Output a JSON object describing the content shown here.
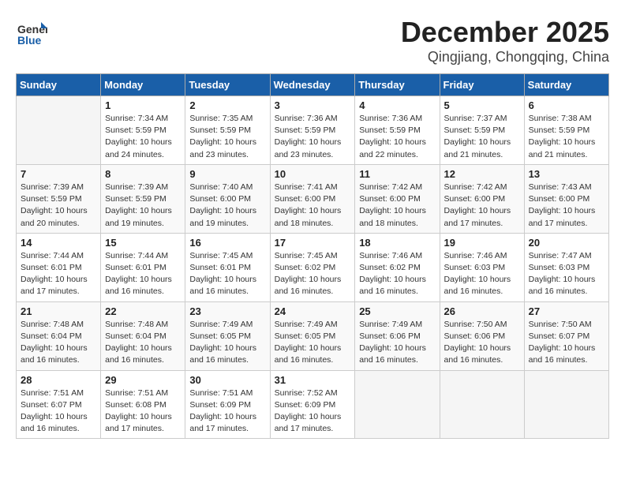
{
  "header": {
    "logo_general": "General",
    "logo_blue": "Blue",
    "month": "December 2025",
    "location": "Qingjiang, Chongqing, China"
  },
  "days_of_week": [
    "Sunday",
    "Monday",
    "Tuesday",
    "Wednesday",
    "Thursday",
    "Friday",
    "Saturday"
  ],
  "weeks": [
    [
      {
        "day": "",
        "info": ""
      },
      {
        "day": "1",
        "info": "Sunrise: 7:34 AM\nSunset: 5:59 PM\nDaylight: 10 hours\nand 24 minutes."
      },
      {
        "day": "2",
        "info": "Sunrise: 7:35 AM\nSunset: 5:59 PM\nDaylight: 10 hours\nand 23 minutes."
      },
      {
        "day": "3",
        "info": "Sunrise: 7:36 AM\nSunset: 5:59 PM\nDaylight: 10 hours\nand 23 minutes."
      },
      {
        "day": "4",
        "info": "Sunrise: 7:36 AM\nSunset: 5:59 PM\nDaylight: 10 hours\nand 22 minutes."
      },
      {
        "day": "5",
        "info": "Sunrise: 7:37 AM\nSunset: 5:59 PM\nDaylight: 10 hours\nand 21 minutes."
      },
      {
        "day": "6",
        "info": "Sunrise: 7:38 AM\nSunset: 5:59 PM\nDaylight: 10 hours\nand 21 minutes."
      }
    ],
    [
      {
        "day": "7",
        "info": "Sunrise: 7:39 AM\nSunset: 5:59 PM\nDaylight: 10 hours\nand 20 minutes."
      },
      {
        "day": "8",
        "info": "Sunrise: 7:39 AM\nSunset: 5:59 PM\nDaylight: 10 hours\nand 19 minutes."
      },
      {
        "day": "9",
        "info": "Sunrise: 7:40 AM\nSunset: 6:00 PM\nDaylight: 10 hours\nand 19 minutes."
      },
      {
        "day": "10",
        "info": "Sunrise: 7:41 AM\nSunset: 6:00 PM\nDaylight: 10 hours\nand 18 minutes."
      },
      {
        "day": "11",
        "info": "Sunrise: 7:42 AM\nSunset: 6:00 PM\nDaylight: 10 hours\nand 18 minutes."
      },
      {
        "day": "12",
        "info": "Sunrise: 7:42 AM\nSunset: 6:00 PM\nDaylight: 10 hours\nand 17 minutes."
      },
      {
        "day": "13",
        "info": "Sunrise: 7:43 AM\nSunset: 6:00 PM\nDaylight: 10 hours\nand 17 minutes."
      }
    ],
    [
      {
        "day": "14",
        "info": "Sunrise: 7:44 AM\nSunset: 6:01 PM\nDaylight: 10 hours\nand 17 minutes."
      },
      {
        "day": "15",
        "info": "Sunrise: 7:44 AM\nSunset: 6:01 PM\nDaylight: 10 hours\nand 16 minutes."
      },
      {
        "day": "16",
        "info": "Sunrise: 7:45 AM\nSunset: 6:01 PM\nDaylight: 10 hours\nand 16 minutes."
      },
      {
        "day": "17",
        "info": "Sunrise: 7:45 AM\nSunset: 6:02 PM\nDaylight: 10 hours\nand 16 minutes."
      },
      {
        "day": "18",
        "info": "Sunrise: 7:46 AM\nSunset: 6:02 PM\nDaylight: 10 hours\nand 16 minutes."
      },
      {
        "day": "19",
        "info": "Sunrise: 7:46 AM\nSunset: 6:03 PM\nDaylight: 10 hours\nand 16 minutes."
      },
      {
        "day": "20",
        "info": "Sunrise: 7:47 AM\nSunset: 6:03 PM\nDaylight: 10 hours\nand 16 minutes."
      }
    ],
    [
      {
        "day": "21",
        "info": "Sunrise: 7:48 AM\nSunset: 6:04 PM\nDaylight: 10 hours\nand 16 minutes."
      },
      {
        "day": "22",
        "info": "Sunrise: 7:48 AM\nSunset: 6:04 PM\nDaylight: 10 hours\nand 16 minutes."
      },
      {
        "day": "23",
        "info": "Sunrise: 7:49 AM\nSunset: 6:05 PM\nDaylight: 10 hours\nand 16 minutes."
      },
      {
        "day": "24",
        "info": "Sunrise: 7:49 AM\nSunset: 6:05 PM\nDaylight: 10 hours\nand 16 minutes."
      },
      {
        "day": "25",
        "info": "Sunrise: 7:49 AM\nSunset: 6:06 PM\nDaylight: 10 hours\nand 16 minutes."
      },
      {
        "day": "26",
        "info": "Sunrise: 7:50 AM\nSunset: 6:06 PM\nDaylight: 10 hours\nand 16 minutes."
      },
      {
        "day": "27",
        "info": "Sunrise: 7:50 AM\nSunset: 6:07 PM\nDaylight: 10 hours\nand 16 minutes."
      }
    ],
    [
      {
        "day": "28",
        "info": "Sunrise: 7:51 AM\nSunset: 6:07 PM\nDaylight: 10 hours\nand 16 minutes."
      },
      {
        "day": "29",
        "info": "Sunrise: 7:51 AM\nSunset: 6:08 PM\nDaylight: 10 hours\nand 17 minutes."
      },
      {
        "day": "30",
        "info": "Sunrise: 7:51 AM\nSunset: 6:09 PM\nDaylight: 10 hours\nand 17 minutes."
      },
      {
        "day": "31",
        "info": "Sunrise: 7:52 AM\nSunset: 6:09 PM\nDaylight: 10 hours\nand 17 minutes."
      },
      {
        "day": "",
        "info": ""
      },
      {
        "day": "",
        "info": ""
      },
      {
        "day": "",
        "info": ""
      }
    ]
  ]
}
